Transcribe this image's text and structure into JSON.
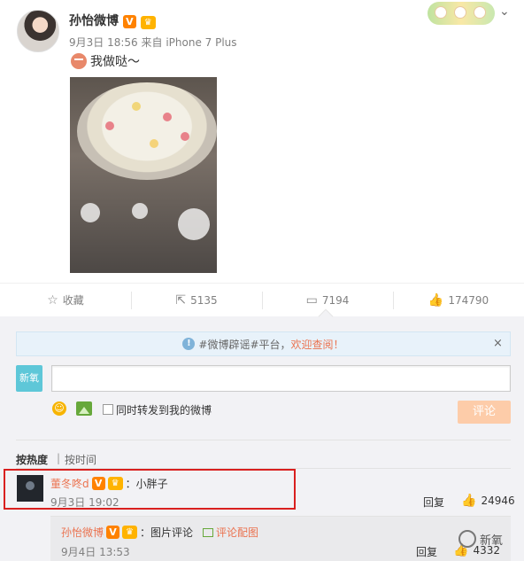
{
  "post": {
    "author": "孙怡微博",
    "verified_badge": "V",
    "time": "9月3日 18:56",
    "source": "来自 iPhone 7 Plus",
    "text": "我做哒～",
    "emoji": "piggy-emoji"
  },
  "actions": {
    "favorite_label": "收藏",
    "repost_count": "5135",
    "comment_count": "7194",
    "like_count": "174790"
  },
  "comment_box": {
    "notice_tag": "#微博辟谣#平台，",
    "notice_link": "欢迎查阅！",
    "close": "×",
    "my_avatar_text": "新氧",
    "input_value": "",
    "repost_label": "同时转发到我的微博",
    "submit_label": "评论",
    "colors": {
      "accent": "#eb7350",
      "submit_bg": "#fdcca9"
    }
  },
  "sort": {
    "hot": "按热度",
    "sep": "|",
    "time": "按时间"
  },
  "comments": [
    {
      "user": "董冬咚d",
      "text": "：小胖子",
      "time": "9月3日 19:02",
      "reply_label": "回复",
      "likes": "24946"
    },
    {
      "user": "孙怡微博",
      "text": "：图片评论",
      "pic_label": "评论配图",
      "time": "9月4日 13:53",
      "reply_label": "回复",
      "likes": "4332"
    }
  ],
  "watermark": {
    "text": "新氧"
  }
}
